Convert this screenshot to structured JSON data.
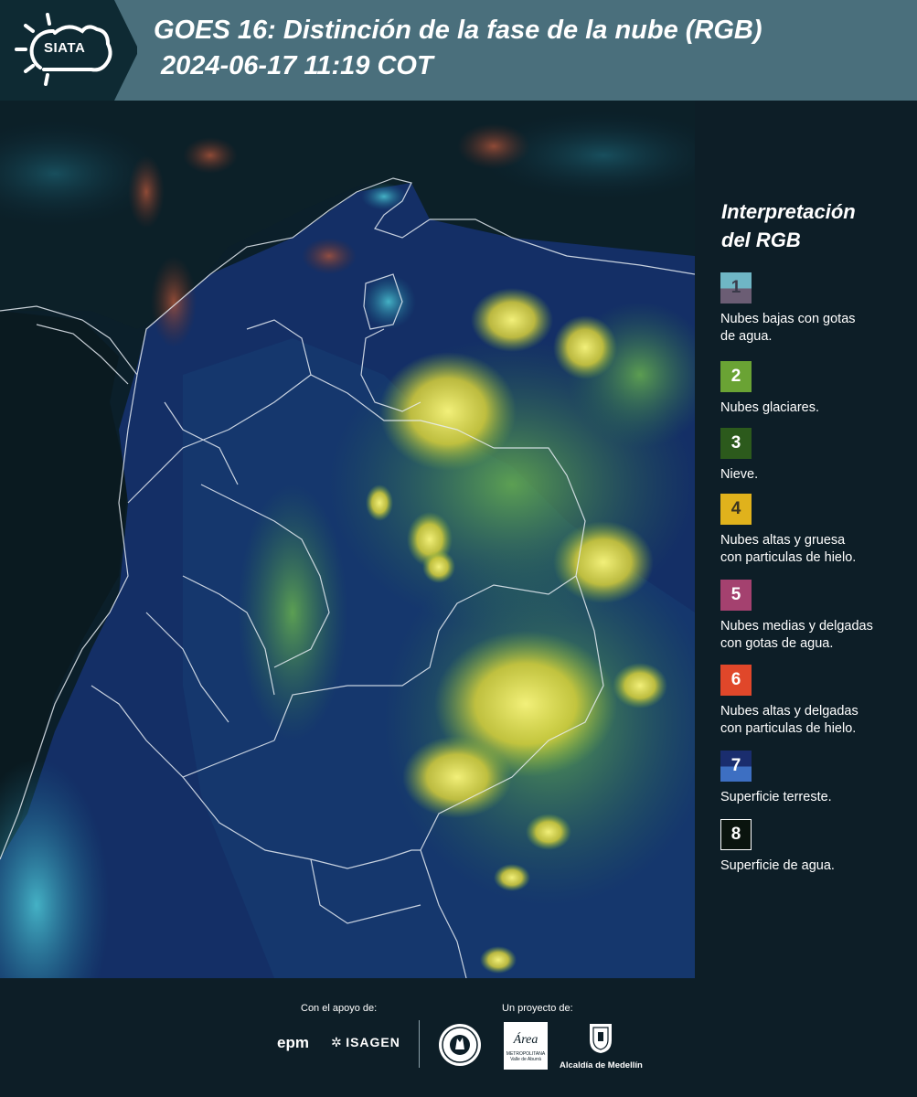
{
  "header": {
    "logo_text": "SIATA",
    "title": "GOES 16: Distinción de la fase de la nube (RGB)",
    "subtitle": "2024-06-17 11:19 COT"
  },
  "legend": {
    "title_line1": "Interpretación",
    "title_line2": "del RGB",
    "items": [
      {
        "number": "1",
        "label_line1": "Nubes bajas con gotas",
        "label_line2": "de agua.",
        "color": "#6fb6c5",
        "color2": "#6b5d74"
      },
      {
        "number": "2",
        "label_line1": "Nubes glaciares.",
        "label_line2": "",
        "color": "#6aa334"
      },
      {
        "number": "3",
        "label_line1": "Nieve.",
        "label_line2": "",
        "color": "#2c5a1c"
      },
      {
        "number": "4",
        "label_line1": "Nubes altas y gruesa",
        "label_line2": "con particulas de hielo.",
        "color": "#e0b21c"
      },
      {
        "number": "5",
        "label_line1": "Nubes medias y delgadas",
        "label_line2": "con gotas de agua.",
        "color": "#a4416f"
      },
      {
        "number": "6",
        "label_line1": "Nubes altas y delgadas",
        "label_line2": "con particulas de hielo.",
        "color": "#e0472a"
      },
      {
        "number": "7",
        "label_line1": "Superficie terreste.",
        "label_line2": "",
        "color": "#1a2d6e",
        "color2": "#3d6fc2"
      },
      {
        "number": "8",
        "label_line1": "Superficie de agua.",
        "label_line2": "",
        "color": "#0a140e"
      }
    ]
  },
  "footer": {
    "support_label": "Con el apoyo de:",
    "project_label": "Un proyecto de:",
    "brand_epm": "epm",
    "brand_isagen": "ISAGEN",
    "brand_area": "Área",
    "brand_area_sub1": "METROPOLITANA",
    "brand_area_sub2": "Valle de Aburrá",
    "brand_alcaldia": "Alcaldía de Medellín"
  },
  "colors": {
    "header_bg": "#4a6f7c",
    "logo_bg": "#0e2a33",
    "panel_bg": "#0d1e27"
  }
}
